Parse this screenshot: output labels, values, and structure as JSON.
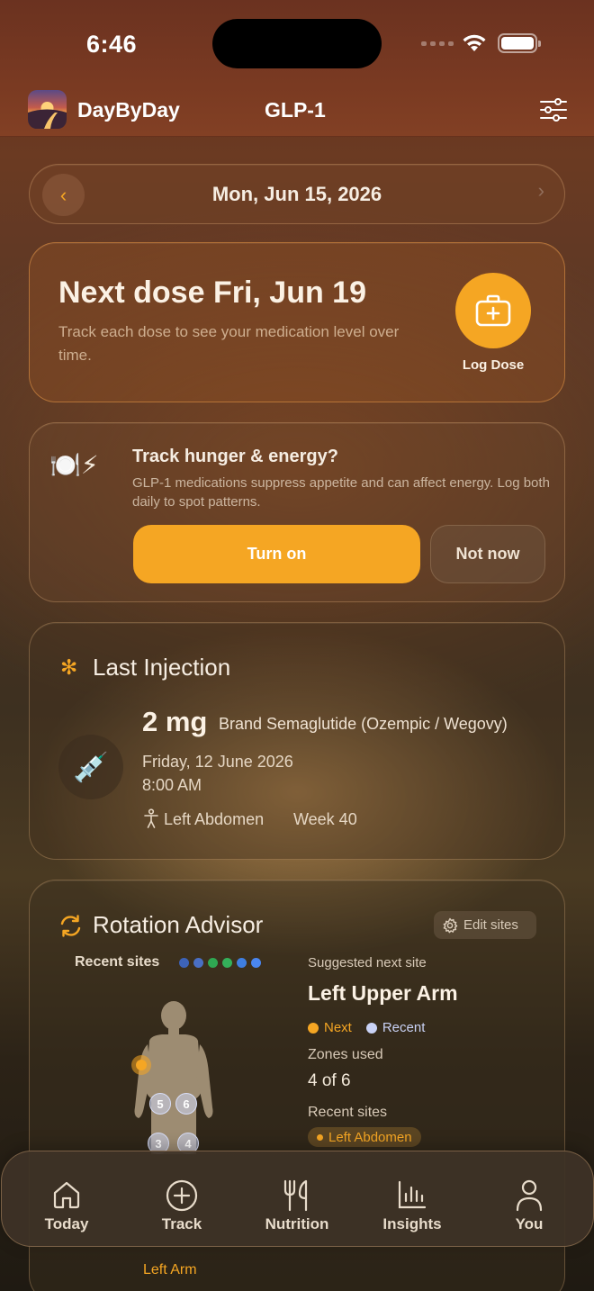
{
  "status_bar": {
    "time": "6:46"
  },
  "nav": {
    "app_name": "DayByDay",
    "title": "GLP-1"
  },
  "date_nav": {
    "label": "Mon, Jun 15, 2026"
  },
  "next_dose": {
    "title": "Next dose Fri, Jun 19",
    "subtitle": "Track each dose to see your medication level over time.",
    "log_label": "Log Dose"
  },
  "hunger": {
    "icons": "🍽️⚡",
    "title": "Track hunger & energy?",
    "subtitle": "GLP-1 medications suppress appetite and can affect energy. Log both daily to spot patterns.",
    "turn_on": "Turn on",
    "not_now": "Not now"
  },
  "last_injection": {
    "title": "Last Injection",
    "dose": "2 mg",
    "brand": "Brand Semaglutide (Ozempic / Wegovy)",
    "date": "Friday, 12 June 2026",
    "time": "8:00 AM",
    "site": "Left Abdomen",
    "week": "Week 40"
  },
  "rotation": {
    "title": "Rotation Advisor",
    "edit_label": "Edit sites",
    "recent_label": "Recent sites",
    "recent_dot_colors": [
      "#3d63b8",
      "#4a6fc4",
      "#2fa852",
      "#34b05a",
      "#3f7ee0",
      "#4a86ef"
    ],
    "suggested_label": "Suggested next site",
    "suggested_site": "Left Upper Arm",
    "legend_next": "Next",
    "legend_recent": "Recent",
    "zones_label": "Zones used",
    "zones_value": "4 of 6",
    "recent_sites_label": "Recent sites",
    "recent_site_chip": "Left Abdomen",
    "markers": [
      "5",
      "6",
      "3",
      "4"
    ],
    "arm_label": "Left Arm"
  },
  "tabs": [
    {
      "label": "Today",
      "icon": "home-icon"
    },
    {
      "label": "Track",
      "icon": "plus-circle-icon"
    },
    {
      "label": "Nutrition",
      "icon": "fork-knife-icon"
    },
    {
      "label": "Insights",
      "icon": "bar-chart-icon"
    },
    {
      "label": "You",
      "icon": "person-icon"
    }
  ],
  "colors": {
    "accent": "#f5a623",
    "text": "#f3e9da"
  }
}
